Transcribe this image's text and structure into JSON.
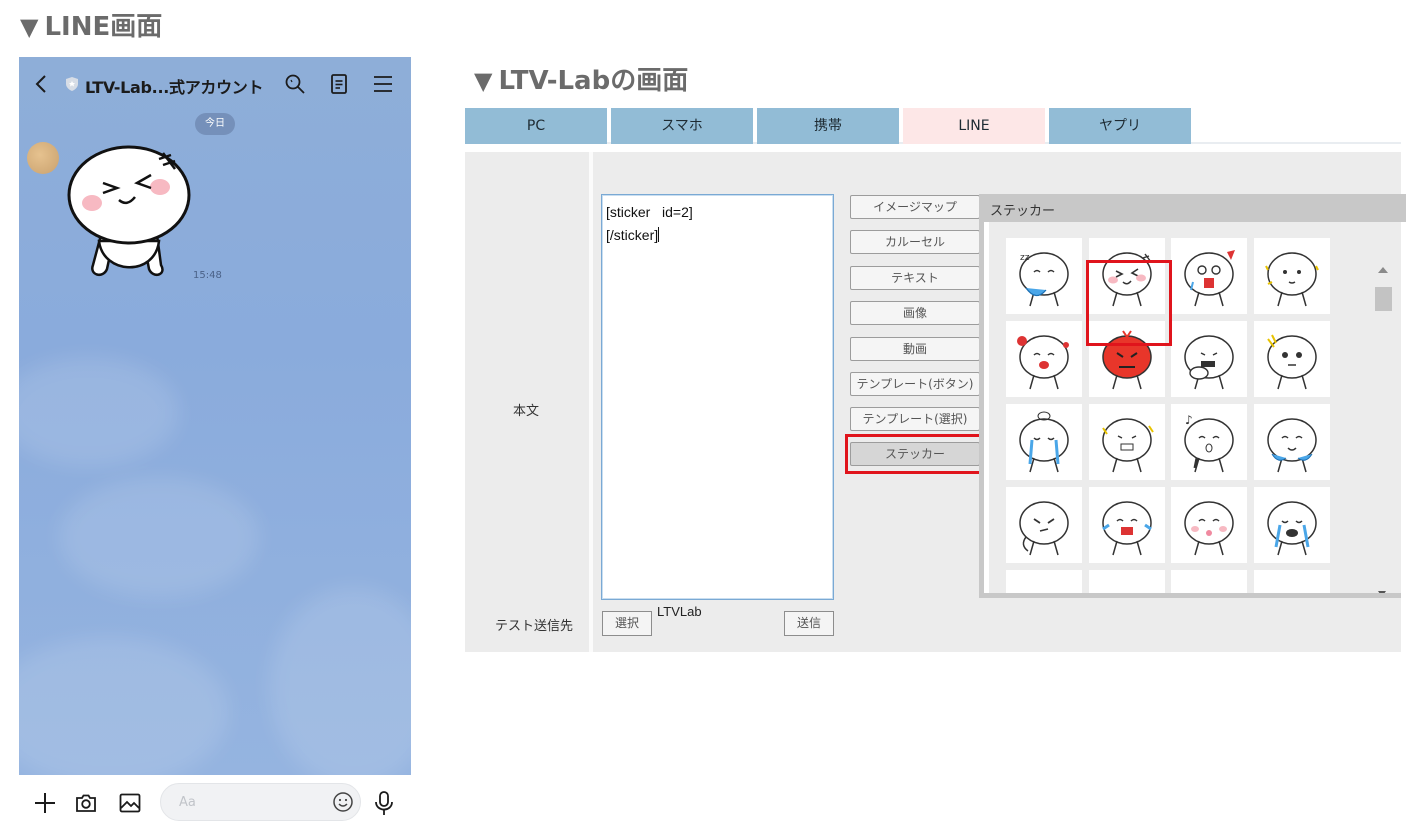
{
  "headings": {
    "line_screen": "LINE画面",
    "ltv_screen": "LTV-Labの画面",
    "marker": "▼"
  },
  "phone": {
    "header": {
      "title": "LTV-Lab...式アカウント",
      "icons": [
        "chevron-left-icon",
        "shield-icon",
        "search-icon",
        "notes-icon",
        "menu-icon"
      ]
    },
    "date_chip": "今日",
    "message": {
      "sticker": "sticker-moon-laughing",
      "time": "15:48"
    },
    "input_bar": {
      "placeholder": "Aa",
      "icons": [
        "plus-icon",
        "camera-icon",
        "image-icon",
        "emoji-icon",
        "mic-icon"
      ]
    }
  },
  "admin": {
    "tabs": [
      {
        "label": "PC",
        "active": false
      },
      {
        "label": "スマホ",
        "active": false
      },
      {
        "label": "携帯",
        "active": false
      },
      {
        "label": "LINE",
        "active": true
      },
      {
        "label": "ヤプリ",
        "active": false
      }
    ],
    "body_label": "本文",
    "test_label": "テスト送信先",
    "textarea_lines": [
      "[sticker   id=2]",
      "[/sticker]"
    ],
    "select_button": "選択",
    "send_button": "送信",
    "test_target_value": "LTVLab",
    "side_buttons": [
      {
        "label": "イメージマップ",
        "active": false
      },
      {
        "label": "カルーセル",
        "active": false
      },
      {
        "label": "テキスト",
        "active": false
      },
      {
        "label": "画像",
        "active": false
      },
      {
        "label": "動画",
        "active": false
      },
      {
        "label": "テンプレート(ボタン)",
        "active": false
      },
      {
        "label": "テンプレート(選択)",
        "active": false
      },
      {
        "label": "ステッカー",
        "active": true
      }
    ],
    "sticker_panel": {
      "title": "ステッカー",
      "selected_index": 1,
      "stickers": [
        "sticker-moon-sleepy",
        "sticker-moon-laughing",
        "sticker-moon-shocked",
        "sticker-moon-sparkle",
        "sticker-moon-love",
        "sticker-moon-angry-red",
        "sticker-moon-thumbsup",
        "sticker-moon-scared",
        "sticker-moon-crying",
        "sticker-moon-cheer",
        "sticker-moon-singing",
        "sticker-moon-happy-tears",
        "sticker-moon-smirk",
        "sticker-moon-tears-joy",
        "sticker-moon-tongue",
        "sticker-moon-sobbing"
      ]
    },
    "colors": {
      "tab_bg": "#92bcd6",
      "tab_active_bg": "#fde7e7",
      "highlight": "#e0141c"
    }
  }
}
